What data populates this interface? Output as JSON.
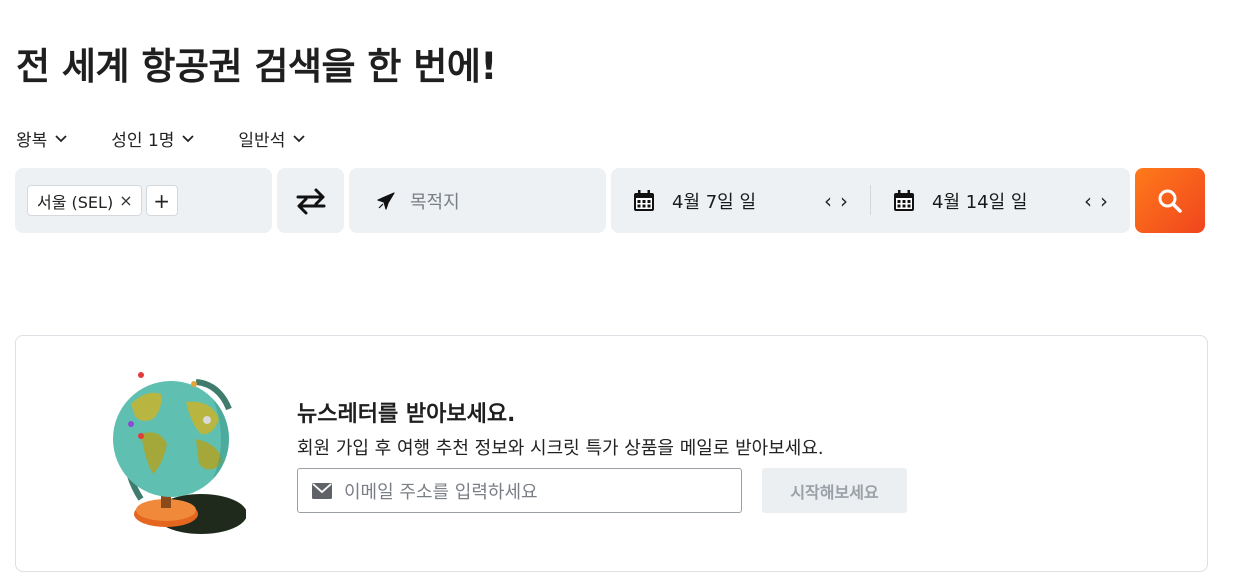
{
  "page": {
    "title": "전 세계 항공권 검색을 한 번에!"
  },
  "options": {
    "trip_type": "왕복",
    "passengers": "성인 1명",
    "cabin": "일반석"
  },
  "search": {
    "origin_chip": "서울 (SEL)",
    "origin_remove": "×",
    "add_origin": "+",
    "destination_placeholder": "목적지",
    "depart_date": "4월 7일 일",
    "return_date": "4월 14일 일",
    "prev": "‹",
    "next": "›"
  },
  "newsletter": {
    "title": "뉴스레터를 받아보세요.",
    "description": "회원 가입 후 여행 추천 정보와 시크릿 특가 상품을 메일로 받아보세요.",
    "email_placeholder": "이메일 주소를 입력하세요",
    "submit_label": "시작해보세요"
  },
  "colors": {
    "accent_start": "#ff7a1a",
    "accent_end": "#f0451e",
    "field_bg": "#eef1f4"
  },
  "icons": {
    "chevron": "chevron-down-icon",
    "swap": "swap-arrows-icon",
    "plane": "plane-icon",
    "calendar": "calendar-icon",
    "search": "search-icon",
    "mail": "mail-icon",
    "globe": "globe-illustration"
  }
}
